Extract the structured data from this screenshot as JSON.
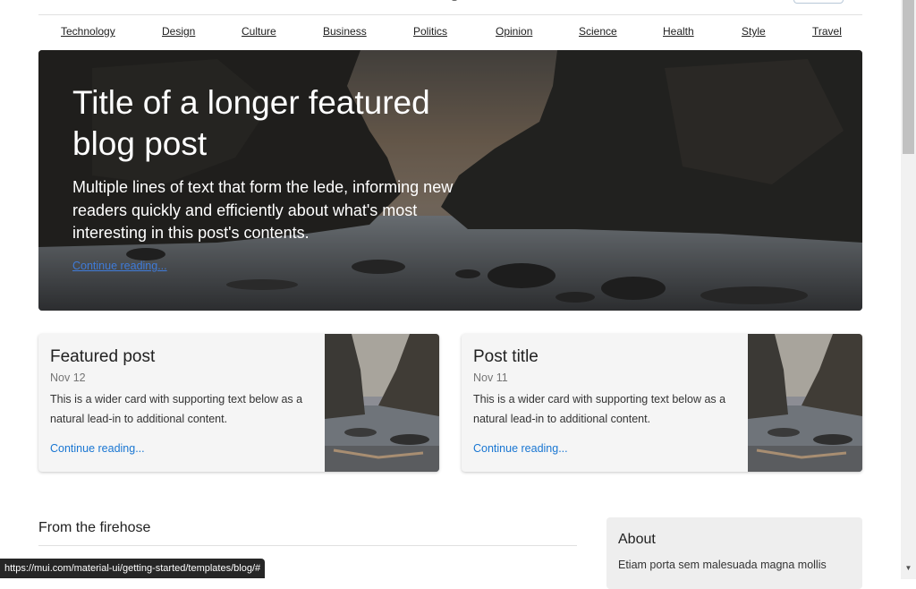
{
  "nav": {
    "sections": [
      "Technology",
      "Design",
      "Culture",
      "Business",
      "Politics",
      "Opinion",
      "Science",
      "Health",
      "Style",
      "Travel"
    ]
  },
  "hero": {
    "title": "Title of a longer featured blog post",
    "lede": "Multiple lines of text that form the lede, informing new readers quickly and efficiently about what's most interesting in this post's contents.",
    "link": "Continue reading..."
  },
  "cards": [
    {
      "title": "Featured post",
      "date": "Nov 12",
      "text": "This is a wider card with supporting text below as a natural lead-in to additional content.",
      "link": "Continue reading..."
    },
    {
      "title": "Post title",
      "date": "Nov 11",
      "text": "This is a wider card with supporting text below as a natural lead-in to additional content.",
      "link": "Continue reading..."
    }
  ],
  "main": {
    "heading": "From the firehose"
  },
  "sidebar": {
    "about_title": "About",
    "about_text": "Etiam porta sem malesuada magna mollis"
  },
  "status": {
    "url": "https://mui.com/material-ui/getting-started/templates/blog/#"
  },
  "colors": {
    "link": "#1976d2",
    "hero_link": "#3f7bd8",
    "card_bg": "#f5f5f5",
    "sidebar_bg": "#eeeeee"
  }
}
